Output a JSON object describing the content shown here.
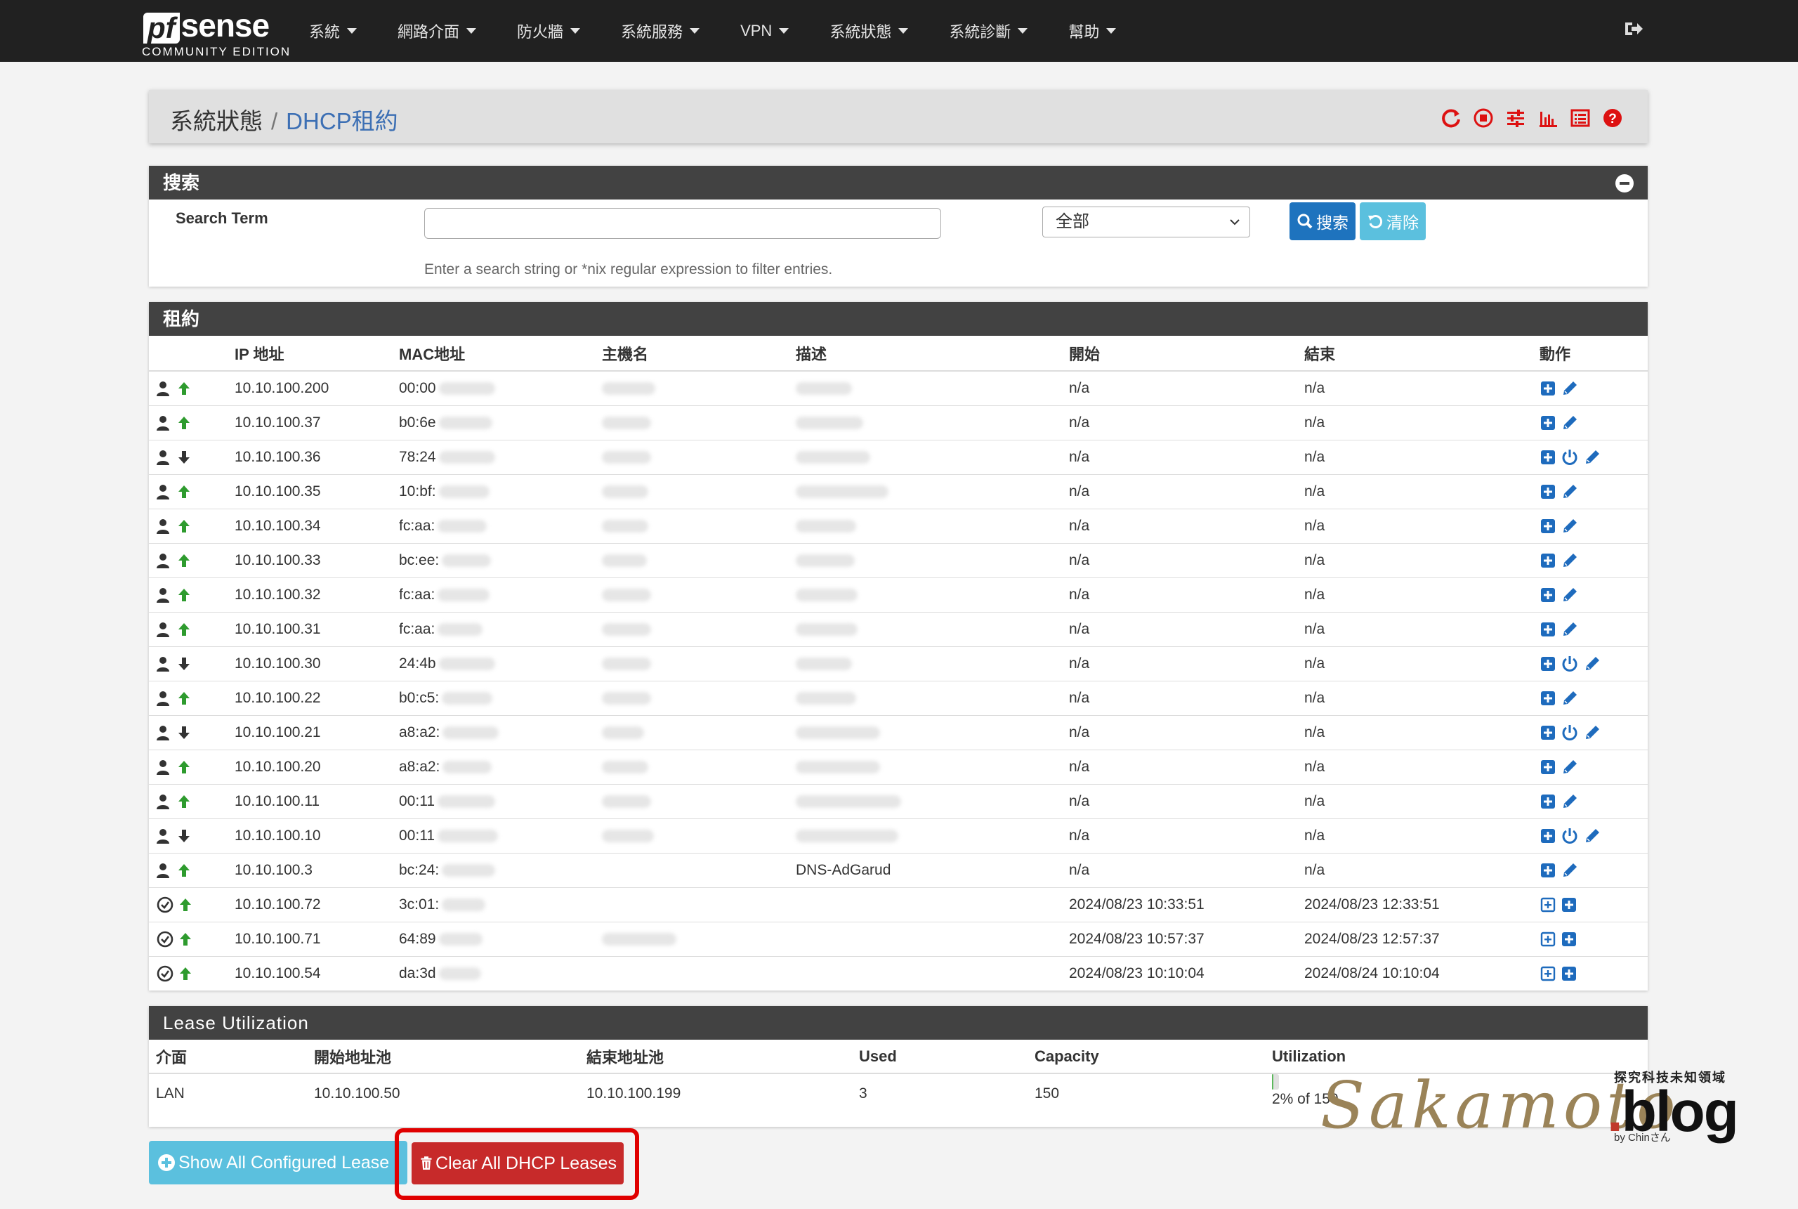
{
  "navbar": {
    "brand_pf": "pf",
    "brand_sense": "sense",
    "brand_sub": "COMMUNITY EDITION",
    "menu": [
      "系統",
      "網路介面",
      "防火牆",
      "系統服務",
      "VPN",
      "系統狀態",
      "系統診斷",
      "幫助"
    ]
  },
  "breadcrumb": {
    "parent": "系統狀態",
    "separator": "/",
    "current": "DHCP租約"
  },
  "search": {
    "title": "搜索",
    "label": "Search Term",
    "input_value": "",
    "select_value": "全部",
    "search_button": "搜索",
    "clear_button": "清除",
    "help": "Enter a search string or *nix regular expression to filter entries."
  },
  "leases": {
    "title": "租約",
    "columns": [
      "IP 地址",
      "MAC地址",
      "主機名",
      "描述",
      "開始",
      "結束",
      "動作"
    ],
    "rows": [
      {
        "ip": "10.10.100.200",
        "mac": "00:00",
        "host": "",
        "desc": "",
        "start": "n/a",
        "end": "n/a"
      },
      {
        "ip": "10.10.100.37",
        "mac": "b0:6e",
        "host": "",
        "desc": "",
        "start": "n/a",
        "end": "n/a"
      },
      {
        "ip": "10.10.100.36",
        "mac": "78:24",
        "host": "",
        "desc": "",
        "start": "n/a",
        "end": "n/a"
      },
      {
        "ip": "10.10.100.35",
        "mac": "10:bf:",
        "host": "",
        "desc": "",
        "start": "n/a",
        "end": "n/a"
      },
      {
        "ip": "10.10.100.34",
        "mac": "fc:aa:",
        "host": "",
        "desc": "",
        "start": "n/a",
        "end": "n/a"
      },
      {
        "ip": "10.10.100.33",
        "mac": "bc:ee:",
        "host": "",
        "desc": "",
        "start": "n/a",
        "end": "n/a"
      },
      {
        "ip": "10.10.100.32",
        "mac": "fc:aa:",
        "host": "",
        "desc": "",
        "start": "n/a",
        "end": "n/a"
      },
      {
        "ip": "10.10.100.31",
        "mac": "fc:aa:",
        "host": "",
        "desc": "",
        "start": "n/a",
        "end": "n/a"
      },
      {
        "ip": "10.10.100.30",
        "mac": "24:4b",
        "host": "",
        "desc": "",
        "start": "n/a",
        "end": "n/a"
      },
      {
        "ip": "10.10.100.22",
        "mac": "b0:c5:",
        "host": "",
        "desc": "",
        "start": "n/a",
        "end": "n/a"
      },
      {
        "ip": "10.10.100.21",
        "mac": "a8:a2:",
        "host": "",
        "desc": "",
        "start": "n/a",
        "end": "n/a"
      },
      {
        "ip": "10.10.100.20",
        "mac": "a8:a2:",
        "host": "",
        "desc": "",
        "start": "n/a",
        "end": "n/a"
      },
      {
        "ip": "10.10.100.11",
        "mac": "00:11",
        "host": "",
        "desc": "",
        "start": "n/a",
        "end": "n/a"
      },
      {
        "ip": "10.10.100.10",
        "mac": "00:11",
        "host": "",
        "desc": "",
        "start": "n/a",
        "end": "n/a"
      },
      {
        "ip": "10.10.100.3",
        "mac": "bc:24:",
        "host": "",
        "desc": "DNS-AdGarud",
        "start": "n/a",
        "end": "n/a"
      },
      {
        "ip": "10.10.100.72",
        "mac": "3c:01:",
        "host": "",
        "desc": "",
        "start": "2024/08/23 10:33:51",
        "end": "2024/08/23 12:33:51"
      },
      {
        "ip": "10.10.100.71",
        "mac": "64:89",
        "host": "",
        "desc": "",
        "start": "2024/08/23 10:57:37",
        "end": "2024/08/23 12:57:37"
      },
      {
        "ip": "10.10.100.54",
        "mac": "da:3d",
        "host": "",
        "desc": "",
        "start": "2024/08/23 10:10:04",
        "end": "2024/08/24 10:10:04"
      }
    ]
  },
  "utilization": {
    "title": "Lease Utilization",
    "columns": [
      "介面",
      "開始地址池",
      "結束地址池",
      "Used",
      "Capacity",
      "Utilization"
    ],
    "row": {
      "iface": "LAN",
      "start": "10.10.100.50",
      "end": "10.10.100.199",
      "used": "3",
      "capacity": "150",
      "util_text": "2% of 150",
      "util_fraction": 0.02
    }
  },
  "buttons": {
    "show_all": "Show All Configured Lease",
    "clear_all": "Clear All DHCP Leases"
  },
  "watermark": {
    "tag": "探究科技未知領域",
    "by": "by Chinさん"
  },
  "colors": {
    "navbar": "#212121",
    "panel_head": "#424242",
    "link_blue": "#3c6fb4",
    "btn_primary": "#1e73be",
    "btn_info": "#5bc0de",
    "btn_danger": "#c72a2a",
    "arrow_green": "#2e9b2e",
    "action_blue": "#1e6bbd",
    "highlight": "#e00000",
    "utilization_bar": "#5cb85c"
  }
}
